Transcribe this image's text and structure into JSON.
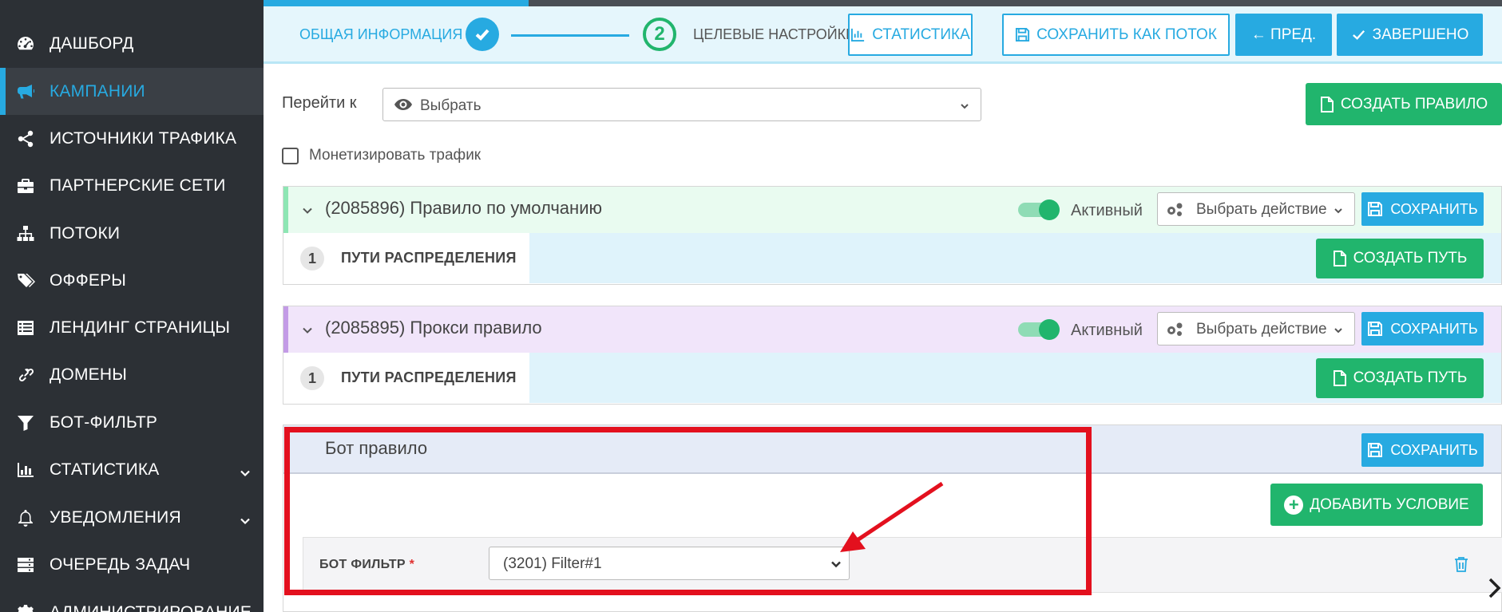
{
  "sidebar": {
    "items": [
      {
        "label": "ДАШБОРД",
        "icon": "dashboard-icon"
      },
      {
        "label": "КАМПАНИИ",
        "icon": "megaphone-icon",
        "active": true
      },
      {
        "label": "ИСТОЧНИКИ ТРАФИКА",
        "icon": "share-icon"
      },
      {
        "label": "ПАРТНЕРСКИЕ СЕТИ",
        "icon": "briefcase-icon"
      },
      {
        "label": "ПОТОКИ",
        "icon": "sitemap-icon"
      },
      {
        "label": "ОФФЕРЫ",
        "icon": "tags-icon"
      },
      {
        "label": "ЛЕНДИНГ СТРАНИЦЫ",
        "icon": "list-icon"
      },
      {
        "label": "ДОМЕНЫ",
        "icon": "link-icon"
      },
      {
        "label": "БОТ-ФИЛЬТР",
        "icon": "filter-icon"
      },
      {
        "label": "СТАТИСТИКА",
        "icon": "bar-chart-icon",
        "has_submenu": true
      },
      {
        "label": "УВЕДОМЛЕНИЯ",
        "icon": "bell-icon",
        "has_submenu": true
      },
      {
        "label": "ОЧЕРЕДЬ ЗАДАЧ",
        "icon": "server-icon"
      },
      {
        "label": "АДМИНИСТРИРОВАНИЕ",
        "icon": "gears-icon",
        "has_submenu": true
      }
    ]
  },
  "top_progress": {
    "fill_fraction": 0.214
  },
  "wizard": {
    "step1_label": "ОБЩАЯ ИНФОРМАЦИЯ",
    "step2_number": "2",
    "step2_label": "ЦЕЛЕВЫЕ НАСТРОЙКИ",
    "stats_button": "СТАТИСТИКА",
    "save_as_flow_button": "СОХРАНИТЬ КАК ПОТОК",
    "prev_button": "← ПРЕД.",
    "done_button": "ЗАВЕРШЕНО"
  },
  "goto": {
    "label": "Перейти к",
    "value": "Выбрать"
  },
  "create_rule_button": "СОЗДАТЬ ПРАВИЛО",
  "monetize_label": "Монетизировать трафик",
  "rules": [
    {
      "title": "(2085896) Правило по умолчанию",
      "status": "Активный",
      "action_placeholder": "Выбрать действие",
      "save": "СОХРАНИТЬ",
      "paths_count": "1",
      "paths_label": "ПУТИ РАСПРЕДЕЛЕНИЯ",
      "create_path": "СОЗДАТЬ ПУТЬ",
      "accent": "#8ee6b4",
      "head_bg": "#e9fbf0"
    },
    {
      "title": "(2085895) Прокси правило",
      "status": "Активный",
      "action_placeholder": "Выбрать действие",
      "save": "СОХРАНИТЬ",
      "paths_count": "1",
      "paths_label": "ПУТИ РАСПРЕДЕЛЕНИЯ",
      "create_path": "СОЗДАТЬ ПУТЬ",
      "accent": "#c39be6",
      "head_bg": "#f1e5fa"
    }
  ],
  "bot_rule": {
    "title": "Бот правило",
    "save": "СОХРАНИТЬ",
    "add_condition": "ДОБАВИТЬ УСЛОВИЕ",
    "filter_label": "БОТ ФИЛЬТР",
    "required_mark": "*",
    "filter_value": "(3201) Filter#1"
  },
  "colors": {
    "primary_blue": "#27aae1",
    "green": "#21b56d",
    "sidebar_bg": "#2c3035",
    "highlight_red": "#e3101e"
  }
}
